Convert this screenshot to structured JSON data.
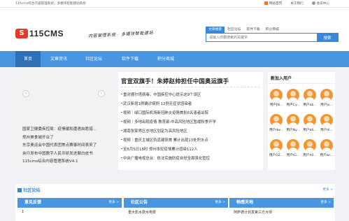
{
  "topbar": {
    "welcome": "115cms综合内容管理系统，多模块智能建站系统",
    "links": [
      {
        "label": "网站首页",
        "color": "#e8743b"
      },
      {
        "label": "关于我们",
        "color": ""
      },
      {
        "label": "会员中心",
        "color": "#999999"
      }
    ]
  },
  "logo": {
    "mark": "S",
    "text": "115CMS"
  },
  "slogan": "内容管理系统 · 多模块智能建站",
  "search": {
    "tabs": [
      "文章搜索",
      "社区论坛",
      "软件下载",
      "积分商城"
    ],
    "active_tab": 0,
    "placeholder": "请输入你要搜索的关键字",
    "button": "搜索"
  },
  "nav": {
    "items": [
      "首页",
      "文章资讯",
      "社区论坛",
      "软件下载",
      "积分商城"
    ],
    "active": 0
  },
  "carousel": {
    "prev": "‹",
    "next": "›"
  },
  "left_list": [
    "国家卫健委疾控局：疫情缓和遭遇自愿措...",
    "郑州美食城开业了",
    "东京奥运会中国代表团焦点赛事时间表来了",
    "央行发布中国数字人民币研发进展白皮书",
    "115cms综合内容管理系统V4.1"
  ],
  "headline": {
    "title": "官宣双旗手！朱婷赵帅担任中国奥运旗手",
    "items": [
      "重对德尔塔病毒，中国疾控中心提示这9个误区",
      "武汉新增1例确诊病例 12例无症状感染者",
      "视频｜绿口国际机场新冠肺炎疫情首批6名患者出院",
      "视频｜多地出现疫情 教育部:中高风险地区暂缓秋季开学",
      "湖南张家界区总地区划定为高风险地区",
      "视频｜重庆主城区轨道建筑首 累计出现13处积水点",
      "至8月5日18时 郑州本轮疫情累计感染112人",
      "中央广播电视总台：依法实施防疫自觉全面强化管控"
    ]
  },
  "users": {
    "title": "新加入用户",
    "list": [
      "用户JN...",
      "用户Cy...",
      "用户ab...",
      "用户Jx...",
      "用户dw...",
      "用户Ny...",
      "用户b6...",
      "用户dl...",
      "用户OZ...",
      "用户lG...",
      "用户h0...",
      "用户wr..."
    ]
  },
  "forum": {
    "title": "社区论坛",
    "more": "更多 >",
    "columns": [
      {
        "title": "意见反馈",
        "more": "更多 >",
        "first": "1"
      },
      {
        "title": "社区公告",
        "more": "更多 >",
        "first": "重大影水费水电费"
      },
      {
        "title": "畅感天地",
        "more": "更多 >",
        "first": "阿萨德计划发第三方大师"
      }
    ]
  }
}
